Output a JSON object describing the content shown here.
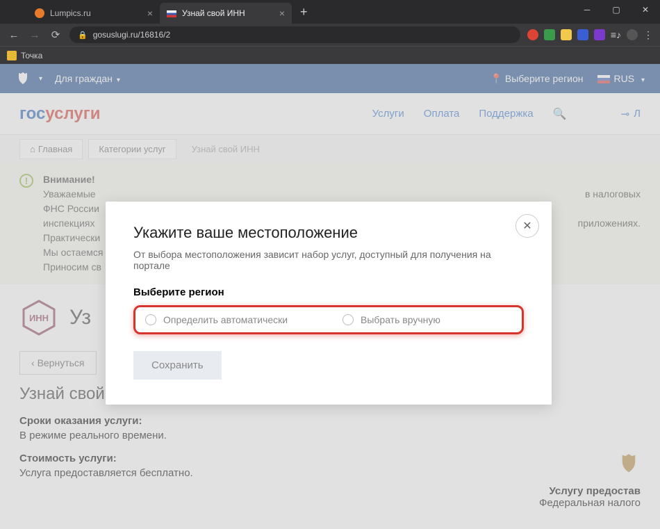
{
  "browser": {
    "tabs": [
      {
        "title": "Lumpics.ru",
        "favicon": "#e87a2b"
      },
      {
        "title": "Узнай свой ИНН",
        "favicon": "flag"
      }
    ],
    "url": "gosuslugi.ru/16816/2",
    "bookmark": "Точка"
  },
  "topbar": {
    "citizens": "Для граждан",
    "region": "Выберите регион",
    "lang": "RUS"
  },
  "logo": {
    "p1": "гос",
    "p2": "услуги"
  },
  "nav": {
    "services": "Услуги",
    "payment": "Оплата",
    "support": "Поддержка",
    "login": "Л"
  },
  "crumbs": {
    "home": "Главная",
    "cats": "Категории услуг",
    "current": "Узнай свой ИНН"
  },
  "alert": {
    "title": "Внимание!",
    "l1": "Уважаемые",
    "l2": "ФНС России",
    "l3": "инспекциях",
    "l4": "Практически",
    "l5": "Мы остаемся",
    "l6": "Приносим св",
    "r1": "в налоговых",
    "r2": "приложениях."
  },
  "page": {
    "title_short": "Уз",
    "back": "Вернуться",
    "title": "Узнай свой ИНН",
    "timing_h": "Сроки оказания услуги:",
    "timing_v": "В режиме реального времени.",
    "cost_h": "Стоимость услуги:",
    "cost_v": "Услуга предоставляется бесплатно.",
    "provider_h": "Услугу предостав",
    "provider_v": "Федеральная налого"
  },
  "modal": {
    "title": "Укажите ваше местоположение",
    "subtitle": "От выбора местоположения зависит набор услуг, доступный для получения на портале",
    "region_label": "Выберите регион",
    "opt_auto": "Определить автоматически",
    "opt_manual": "Выбрать вручную",
    "save": "Сохранить"
  }
}
